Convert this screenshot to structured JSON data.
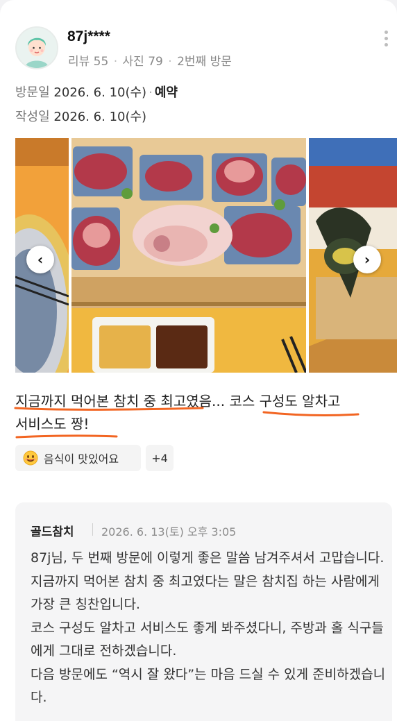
{
  "review": {
    "username": "87j****",
    "reviews_label": "리뷰 55",
    "photos_label": "사진 79",
    "visit_count_label": "2번째 방문",
    "visit_date_label": "방문일",
    "visit_date": "2026. 6. 10(수)",
    "reservation": "예약",
    "written_date_label": "작성일",
    "written_date": "2026. 6. 10(수)",
    "text_part1": "지금까지 먹어본 참치 중 최고",
    "text_part2": "였음... ",
    "text_part3": "코스 구성도 알차고",
    "text_part4": "서비스도 짱!",
    "tags": [
      {
        "icon": "smile-emoji-icon",
        "label": "음식이 맛있어요"
      },
      {
        "label": "+4"
      }
    ]
  },
  "reply": {
    "owner": "골드참치",
    "date": "2026. 6. 13(토) 오후 3:05",
    "lines": [
      "87j님, 두 번째 방문에 이렇게 좋은 말씀 남겨주셔서 고맙습니다.",
      "지금까지 먹어본 참치 중 최고였다는 말은 참치집 하는 사람에게 가장 큰 칭찬입니다.",
      "코스 구성도 알차고 서비스도 좋게 봐주셨다니, 주방과 홀 식구들에게 그대로 전하겠습니다.",
      "다음 방문에도 “역시 잘 왔다”는 마음 드실 수 있게 준비하겠습니다."
    ]
  },
  "colors": {
    "underline": "#f26522",
    "tag_bg": "#f4f4f4",
    "reply_bg": "#f5f5f6"
  }
}
